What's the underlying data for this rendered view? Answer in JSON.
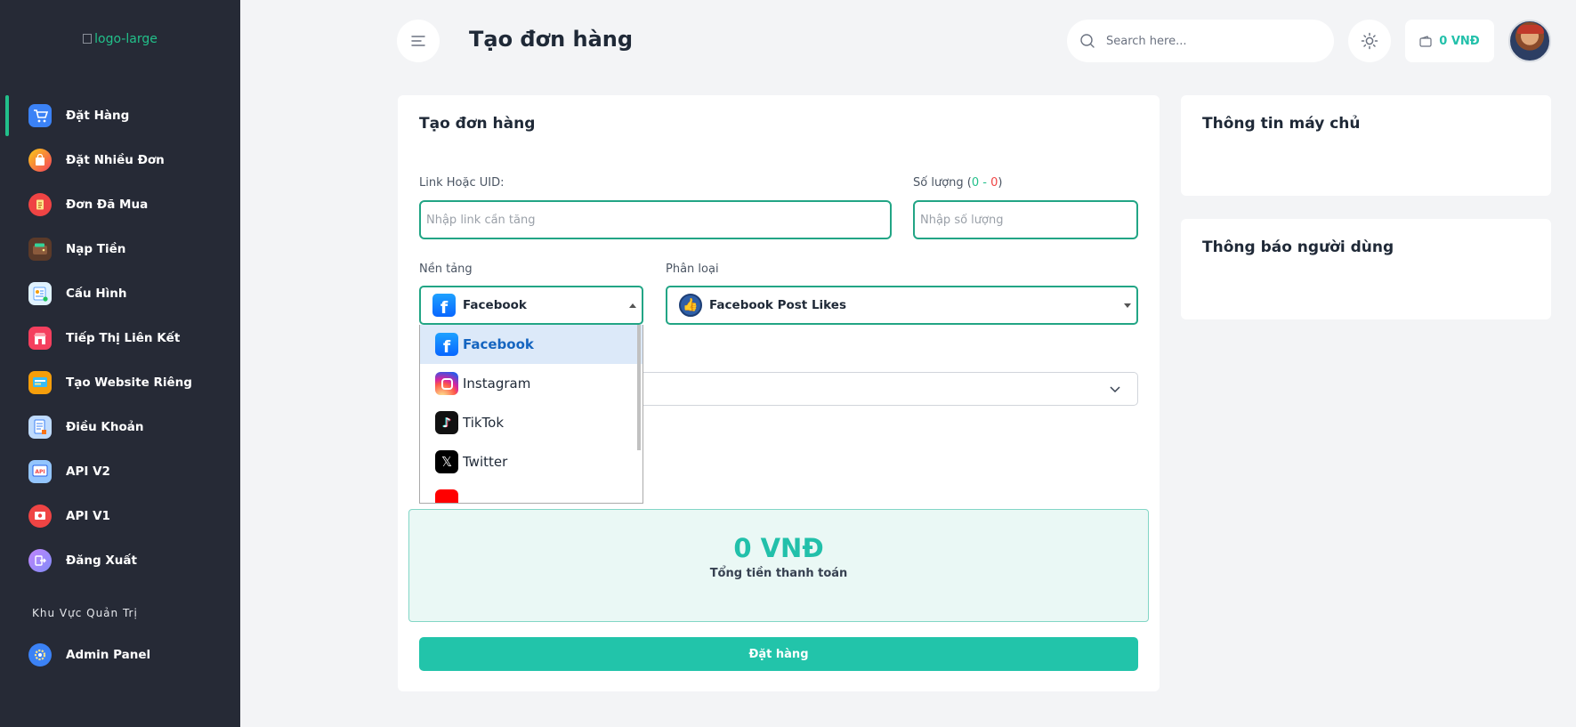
{
  "logo_alt": "logo-large",
  "sidebar": {
    "items": [
      {
        "label": "Đặt Hàng",
        "icon": "cart-icon",
        "active": true
      },
      {
        "label": "Đặt Nhiều Đơn",
        "icon": "shopping-bag-icon"
      },
      {
        "label": "Đơn Đã Mua",
        "icon": "receipt-icon"
      },
      {
        "label": "Nạp Tiền",
        "icon": "wallet-icon"
      },
      {
        "label": "Cấu Hình",
        "icon": "profile-card-icon"
      },
      {
        "label": "Tiếp Thị Liên Kết",
        "icon": "store-icon"
      },
      {
        "label": "Tạo Website Riêng",
        "icon": "website-icon"
      },
      {
        "label": "Điều Khoản",
        "icon": "document-icon"
      },
      {
        "label": "API V2",
        "icon": "api-v2-icon"
      },
      {
        "label": "API V1",
        "icon": "api-v1-icon"
      },
      {
        "label": "Đăng Xuất",
        "icon": "logout-icon"
      }
    ],
    "section_label": "Khu Vực Quản Trị",
    "admin_label": "Admin Panel"
  },
  "header": {
    "title": "Tạo đơn hàng",
    "search_placeholder": "Search here...",
    "balance": "0 VNĐ"
  },
  "form": {
    "title": "Tạo đơn hàng",
    "link_label": "Link Hoặc UID:",
    "link_placeholder": "Nhập link cần tăng",
    "qty_label": "Số lượng (",
    "qty_min": "0",
    "qty_sep": " - ",
    "qty_max": "0",
    "qty_close": ")",
    "qty_placeholder": "Nhập số lượng",
    "platform_label": "Nền tảng",
    "platform_value": "Facebook",
    "category_label": "Phân loại",
    "category_value": "Facebook Post Likes",
    "platform_options": [
      "Facebook",
      "Instagram",
      "TikTok",
      "Twitter"
    ],
    "total_amount": "0 VNĐ",
    "total_label": "Tổng tiền thanh toán",
    "submit_label": "Đặt hàng"
  },
  "side": {
    "server_info_title": "Thông tin máy chủ",
    "user_notice_title": "Thông báo người dùng"
  },
  "colors": {
    "sidebar_bg": "#262a36",
    "accent": "#22c4aa",
    "input_border": "#22a585",
    "selected_option_bg": "#dce9f9"
  }
}
